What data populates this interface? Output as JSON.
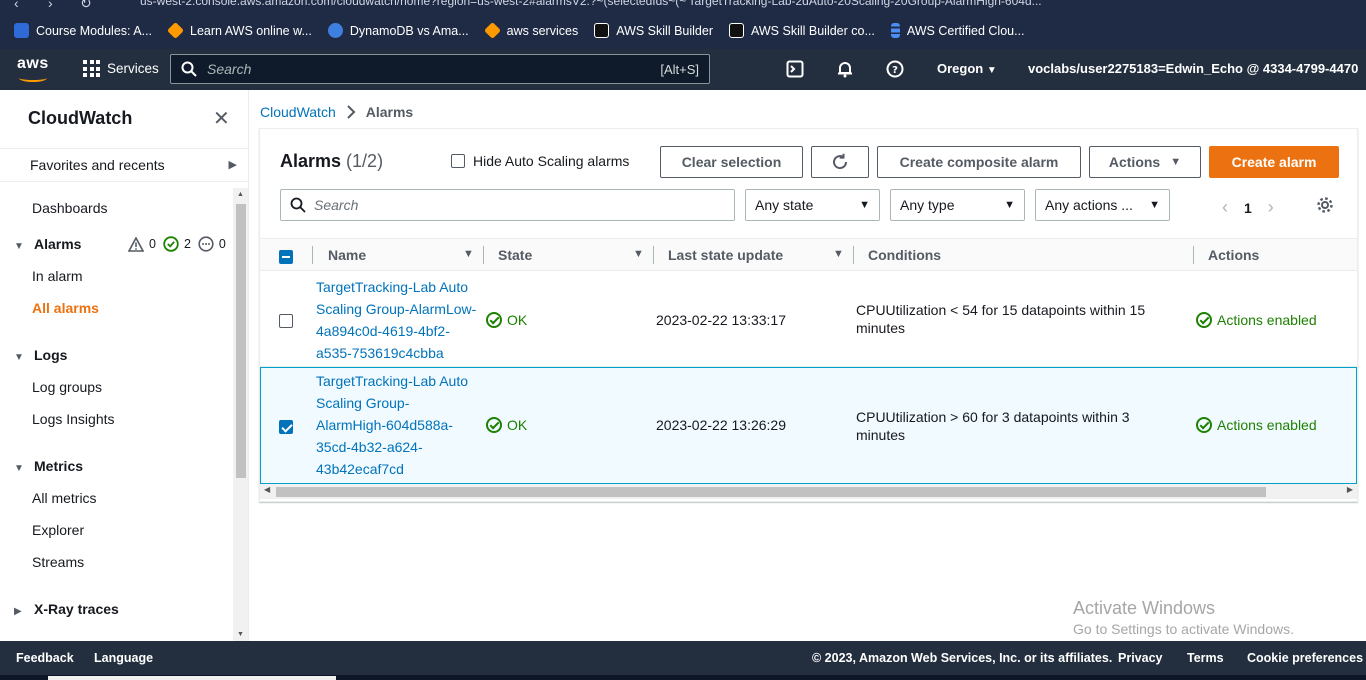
{
  "browser": {
    "url_fragment": "us-west-2.console.aws.amazon.com/cloudwatch/home?region=us-west-2#alarmsV2:?~(selectedIds~(~'TargetTracking-Lab-2dAuto-20Scaling-20Group-AlarmHigh-604d...",
    "bookmarks": [
      {
        "label": "Course Modules: A...",
        "color": "#2f6bd6"
      },
      {
        "label": "Learn AWS online w...",
        "color": "#ff9900"
      },
      {
        "label": "DynamoDB vs Ama...",
        "color": "#3f7fe0"
      },
      {
        "label": "aws services",
        "color": "#ff9900"
      },
      {
        "label": "AWS Skill Builder",
        "color": "#ffffff"
      },
      {
        "label": "AWS Skill Builder co...",
        "color": "#ffffff"
      },
      {
        "label": "AWS Certified Clou...",
        "color": "#4c8df6"
      }
    ]
  },
  "topnav": {
    "logo": "aws",
    "services": "Services",
    "search_placeholder": "Search",
    "search_shortcut": "[Alt+S]",
    "region": "Oregon",
    "account": "voclabs/user2275183=Edwin_Echo @ 4334-4799-4470"
  },
  "sidenav": {
    "title": "CloudWatch",
    "favorites": "Favorites and recents",
    "dashboards": "Dashboards",
    "alarms": "Alarms",
    "alarm_counts": {
      "alarm": "0",
      "ok": "2",
      "insufficient": "0"
    },
    "in_alarm": "In alarm",
    "all_alarms": "All alarms",
    "logs": "Logs",
    "log_groups": "Log groups",
    "logs_insights": "Logs Insights",
    "metrics": "Metrics",
    "all_metrics": "All metrics",
    "explorer": "Explorer",
    "streams": "Streams",
    "xray": "X-Ray traces"
  },
  "breadcrumb": {
    "root": "CloudWatch",
    "current": "Alarms"
  },
  "panel": {
    "title": "Alarms",
    "count": "(1/2)",
    "hide_autoscaling": "Hide Auto Scaling alarms",
    "clear_selection": "Clear selection",
    "create_composite": "Create composite alarm",
    "actions": "Actions",
    "create_alarm": "Create alarm",
    "search_placeholder": "Search",
    "filter_state": "Any state",
    "filter_type": "Any type",
    "filter_actions": "Any actions ...",
    "page": "1"
  },
  "table": {
    "headers": {
      "name": "Name",
      "state": "State",
      "last_update": "Last state update",
      "conditions": "Conditions",
      "actions": "Actions"
    },
    "rows": [
      {
        "name_lines": [
          "TargetTracking-Lab Auto",
          "Scaling Group-AlarmLow-",
          "4a894c0d-4619-4bf2-",
          "a535-753619c4cbba"
        ],
        "state": "OK",
        "last_update": "2023-02-22 13:33:17",
        "condition_lines": [
          "CPUUtilization < 54 for 15 datapoints within 15",
          "minutes"
        ],
        "actions": "Actions enabled",
        "selected": false
      },
      {
        "name_lines": [
          "TargetTracking-Lab Auto",
          "Scaling Group-",
          "AlarmHigh-604d588a-",
          "35cd-4b32-a624-",
          "43b42ecaf7cd"
        ],
        "state": "OK",
        "last_update": "2023-02-22 13:26:29",
        "condition_lines": [
          "CPUUtilization > 60 for 3 datapoints within 3",
          "minutes"
        ],
        "actions": "Actions enabled",
        "selected": true
      }
    ]
  },
  "footer": {
    "feedback": "Feedback",
    "language": "Language",
    "copyright": "© 2023, Amazon Web Services, Inc. or its affiliates.",
    "privacy": "Privacy",
    "terms": "Terms",
    "cookies": "Cookie preferences"
  },
  "watermark": {
    "line1": "Activate Windows",
    "line2": "Go to Settings to activate Windows."
  },
  "colors": {
    "accent": "#ec7211",
    "link": "#0073bb",
    "ok": "#1d8102",
    "nav": "#232f3e"
  }
}
